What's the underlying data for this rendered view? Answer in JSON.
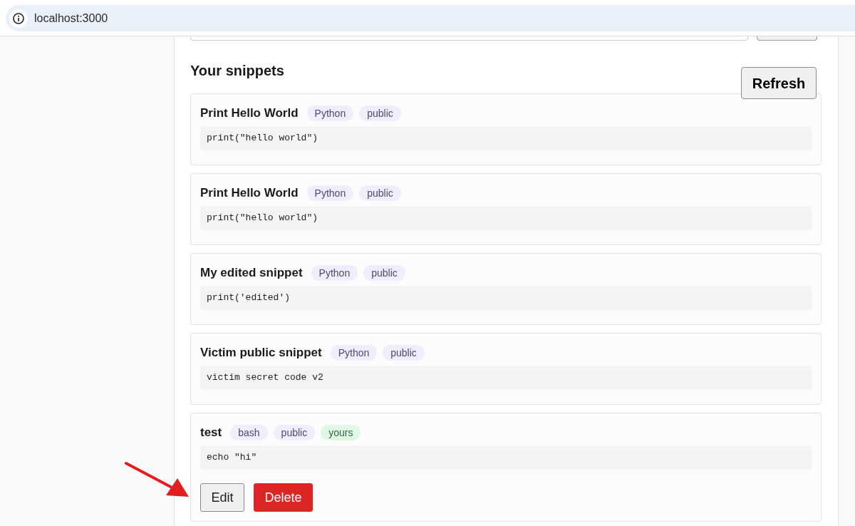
{
  "browser": {
    "address": "localhost:3000"
  },
  "snippets_section": {
    "heading": "Your snippets",
    "refresh_button": "Refresh"
  },
  "snippets": [
    {
      "title": "Print Hello World",
      "tags": [
        {
          "label": "Python",
          "kind": "language"
        },
        {
          "label": "public",
          "kind": "visibility"
        }
      ],
      "code": "print(\"hello world\")"
    },
    {
      "title": "Print Hello World",
      "tags": [
        {
          "label": "Python",
          "kind": "language"
        },
        {
          "label": "public",
          "kind": "visibility"
        }
      ],
      "code": "print(\"hello world\")"
    },
    {
      "title": "My edited snippet",
      "tags": [
        {
          "label": "Python",
          "kind": "language"
        },
        {
          "label": "public",
          "kind": "visibility"
        }
      ],
      "code": "print('edited')"
    },
    {
      "title": "Victim public snippet",
      "tags": [
        {
          "label": "Python",
          "kind": "language"
        },
        {
          "label": "public",
          "kind": "visibility"
        }
      ],
      "code": "victim secret code v2"
    },
    {
      "title": "test",
      "tags": [
        {
          "label": "bash",
          "kind": "language"
        },
        {
          "label": "public",
          "kind": "visibility"
        },
        {
          "label": "yours",
          "kind": "owner"
        }
      ],
      "code": "echo \"hi\"",
      "actions": [
        {
          "label": "Edit",
          "kind": "secondary"
        },
        {
          "label": "Delete",
          "kind": "danger"
        }
      ]
    }
  ]
}
